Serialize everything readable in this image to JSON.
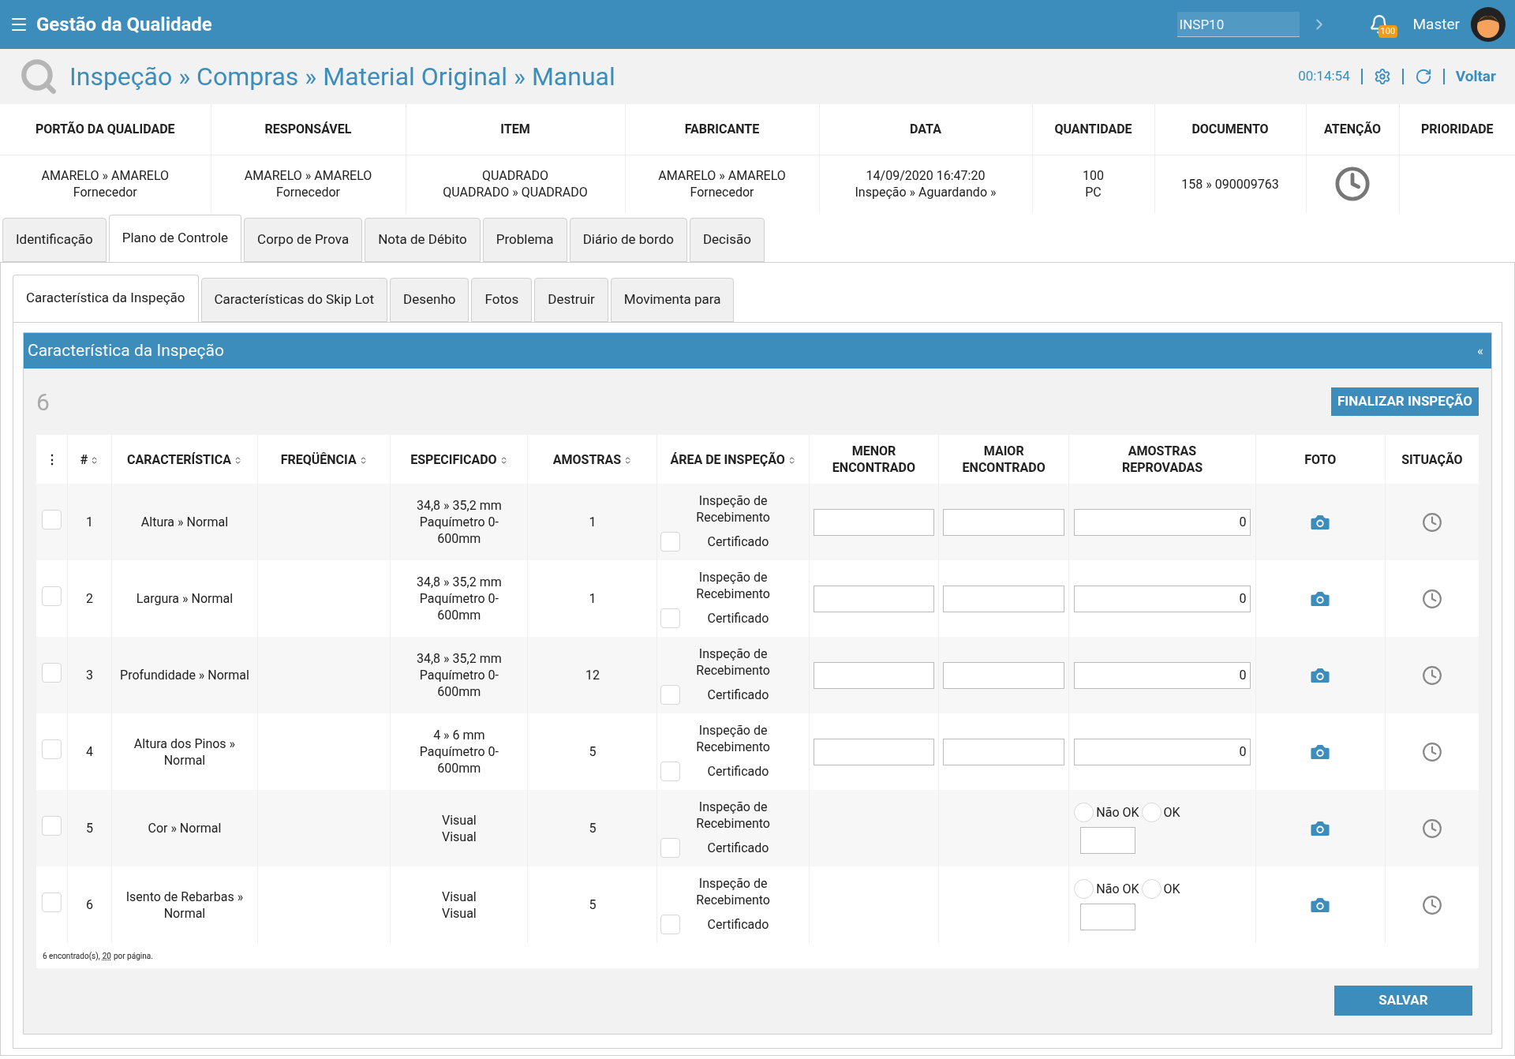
{
  "app": {
    "title": "Gestão da Qualidade",
    "search_value": "INSP10",
    "notification_count": "100",
    "user": "Master"
  },
  "breadcrumb": {
    "path": "Inspeção » Compras » Material Original » Manual",
    "timer": "00:14:54",
    "back": "Voltar"
  },
  "summary": {
    "columns": [
      "PORTÃO DA QUALIDADE",
      "RESPONSÁVEL",
      "ITEM",
      "FABRICANTE",
      "DATA",
      "QUANTIDADE",
      "DOCUMENTO",
      "ATENÇÃO",
      "PRIORIDADE"
    ],
    "values": [
      {
        "kind": "text",
        "lines": [
          "AMARELO » AMARELO",
          "Fornecedor"
        ]
      },
      {
        "kind": "text",
        "lines": [
          "AMARELO » AMARELO",
          "Fornecedor"
        ]
      },
      {
        "kind": "text",
        "lines": [
          "QUADRADO",
          "QUADRADO » QUADRADO"
        ]
      },
      {
        "kind": "text",
        "lines": [
          "AMARELO » AMARELO",
          "Fornecedor"
        ]
      },
      {
        "kind": "text",
        "lines": [
          "14/09/2020 16:47:20",
          "Inspeção » Aguardando »"
        ]
      },
      {
        "kind": "text",
        "lines": [
          "100",
          "PC"
        ]
      },
      {
        "kind": "text",
        "lines": [
          "158 » 090009763"
        ]
      },
      {
        "kind": "clock"
      },
      {
        "kind": "empty"
      }
    ]
  },
  "tabs": [
    {
      "label": "Identificação",
      "selected": false
    },
    {
      "label": "Plano de Controle",
      "selected": true
    },
    {
      "label": "Corpo de Prova",
      "selected": false
    },
    {
      "label": "Nota de Débito",
      "selected": false
    },
    {
      "label": "Problema",
      "selected": false
    },
    {
      "label": "Diário de bordo",
      "selected": false
    },
    {
      "label": "Decisão",
      "selected": false
    }
  ],
  "subtabs": [
    {
      "label": "Característica da Inspeção",
      "selected": true
    },
    {
      "label": "Características do Skip Lot",
      "selected": false
    },
    {
      "label": "Desenho",
      "selected": false
    },
    {
      "label": "Fotos",
      "selected": false
    },
    {
      "label": "Destruir",
      "selected": false
    },
    {
      "label": "Movimenta para",
      "selected": false
    }
  ],
  "panel": {
    "title": "Característica da Inspeção",
    "collapse": "«",
    "count": "6",
    "finalize_button": "FINALIZAR INSPEÇÃO"
  },
  "table": {
    "columns": [
      {
        "label": "⋮",
        "sortable": false
      },
      {
        "label": "#",
        "sortable": true
      },
      {
        "label": "CARACTERÍSTICA",
        "sortable": true
      },
      {
        "label": "FREQÜÊNCIA",
        "sortable": true
      },
      {
        "label": "ESPECIFICADO",
        "sortable": true
      },
      {
        "label": "AMOSTRAS",
        "sortable": true
      },
      {
        "label": "ÁREA DE INSPEÇÃO",
        "sortable": true
      },
      {
        "label": "MENOR ENCONTRADO",
        "sortable": false
      },
      {
        "label": "MAIOR ENCONTRADO",
        "sortable": false
      },
      {
        "label": "AMOSTRAS REPROVADAS",
        "sortable": false
      },
      {
        "label": "FOTO",
        "sortable": false
      },
      {
        "label": "SITUAÇÃO",
        "sortable": false
      }
    ],
    "rows": [
      {
        "kind": "numeric",
        "checked": false,
        "number": "1",
        "characteristic": "Altura » Normal",
        "specified": [
          "34,8 » 35,2 mm",
          "Paquímetro 0-600mm"
        ],
        "samples": "1",
        "area": "Inspeção de Recebimento",
        "certificate": {
          "label": "Certificado",
          "checked": false
        },
        "rejected": "0"
      },
      {
        "kind": "numeric",
        "checked": false,
        "number": "2",
        "characteristic": "Largura » Normal",
        "specified": [
          "34,8 » 35,2 mm",
          "Paquímetro 0-600mm"
        ],
        "samples": "1",
        "area": "Inspeção de Recebimento",
        "certificate": {
          "label": "Certificado",
          "checked": false
        },
        "rejected": "0"
      },
      {
        "kind": "numeric",
        "checked": false,
        "number": "3",
        "characteristic": "Profundidade » Normal",
        "specified": [
          "34,8 » 35,2 mm",
          "Paquímetro 0-600mm"
        ],
        "samples": "12",
        "area": "Inspeção de Recebimento",
        "certificate": {
          "label": "Certificado",
          "checked": false
        },
        "rejected": "0"
      },
      {
        "kind": "numeric",
        "checked": false,
        "number": "4",
        "characteristic": "Altura dos Pinos » Normal",
        "specified": [
          "4 » 6 mm",
          "Paquímetro 0-600mm"
        ],
        "samples": "5",
        "area": "Inspeção de Recebimento",
        "certificate": {
          "label": "Certificado",
          "checked": false
        },
        "rejected": "0"
      },
      {
        "kind": "radio",
        "checked": false,
        "number": "5",
        "characteristic": "Cor » Normal",
        "specified": [
          "Visual",
          "Visual"
        ],
        "samples": "5",
        "area": "Inspeção de Recebimento",
        "certificate": {
          "label": "Certificado",
          "checked": false
        },
        "options": [
          {
            "label": "Não OK",
            "selected": false
          },
          {
            "label": "OK",
            "selected": false
          }
        ]
      },
      {
        "kind": "radio",
        "checked": false,
        "number": "6",
        "characteristic": "Isento de Rebarbas » Normal",
        "specified": [
          "Visual",
          "Visual"
        ],
        "samples": "5",
        "area": "Inspeção de Recebimento",
        "certificate": {
          "label": "Certificado",
          "checked": false
        },
        "options": [
          {
            "label": "Não OK",
            "selected": false
          },
          {
            "label": "OK",
            "selected": false
          }
        ]
      }
    ]
  },
  "footer": {
    "found": "6 encontrado(s),",
    "page_size": "20",
    "per_page": "por página."
  },
  "save_button": "SALVAR"
}
